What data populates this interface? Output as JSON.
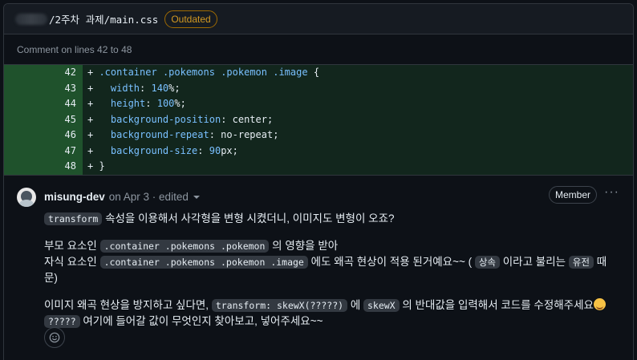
{
  "file": {
    "path": "/2주차 과제/main.css",
    "badge": "Outdated"
  },
  "comment_on": "Comment on lines 42 to 48",
  "diff_lines": [
    {
      "num": "42",
      "code": "+ .container .pokemons .pokemon .image {"
    },
    {
      "num": "43",
      "code": "+   width: 140%;"
    },
    {
      "num": "44",
      "code": "+   height: 100%;"
    },
    {
      "num": "45",
      "code": "+   background-position: center;"
    },
    {
      "num": "46",
      "code": "+   background-repeat: no-repeat;"
    },
    {
      "num": "47",
      "code": "+   background-size: 90px;"
    },
    {
      "num": "48",
      "code": "+ }"
    }
  ],
  "comment": {
    "author": "misung-dev",
    "meta": "on Apr 3 · edited",
    "role": "Member",
    "menu": "···",
    "p1": {
      "code": "transform",
      "text": " 속성을 이용해서 사각형을 변형 시켰더니, 이미지도 변형이 오죠?"
    },
    "p2": {
      "l1_pre": "부모 요소인 ",
      "l1_code": ".container .pokemons .pokemon",
      "l1_post": " 의 영향을 받아",
      "l2_pre": "자식 요소인 ",
      "l2_code": ".container .pokemons .pokemon .image",
      "l2_mid": " 에도 왜곡 현상이 적용 된거예요~~ ( ",
      "l2_code2": "상속",
      "l2_mid2": " 이라고 불리는 ",
      "l2_code3": "유전",
      "l2_post": " 때문)"
    },
    "p3": {
      "l1_pre": "이미지 왜곡 현상을 방지하고 싶다면, ",
      "l1_code": "transform: skewX(?????)",
      "l1_mid": " 에 ",
      "l1_code2": "skewX",
      "l1_post": " 의 반대값을 입력해서 코드를 수정해주세요",
      "l2_code": "?????",
      "l2_post": " 여기에 들어갈 값이 무엇인지 찾아보고, 넣어주세요~~"
    },
    "emoji_icon": "smiling-face-icon",
    "reaction_icon": "add-reaction-smiley-icon"
  }
}
